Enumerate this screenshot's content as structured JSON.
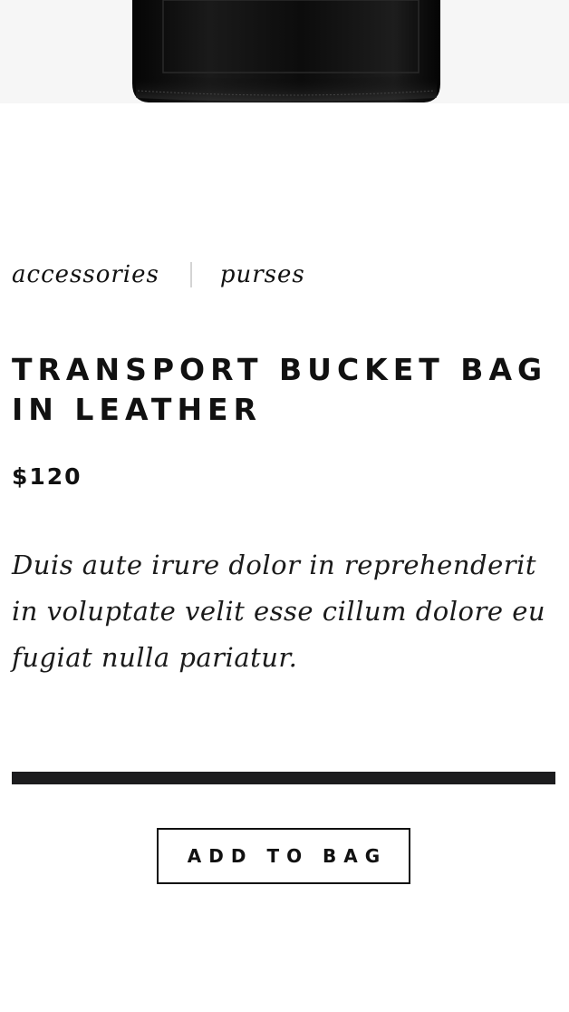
{
  "product_image": {
    "alt": "Transport bucket bag in leather",
    "background_color": "#f6f6f6",
    "bag_color": "#0e0e0e"
  },
  "breadcrumb": {
    "category": "accessories",
    "subcategory": "purses"
  },
  "product": {
    "title": "TRANSPORT BUCKET BAG IN LEATHER",
    "price": "$120",
    "description": "Duis aute irure dolor in reprehenderit in voluptate velit esse cillum dolore eu fugiat nulla pariatur."
  },
  "actions": {
    "add_to_bag_label": "ADD TO BAG"
  },
  "colors": {
    "text": "#111111",
    "divider": "#1c1c1e",
    "separator": "#d4d4d4",
    "background": "#ffffff"
  }
}
